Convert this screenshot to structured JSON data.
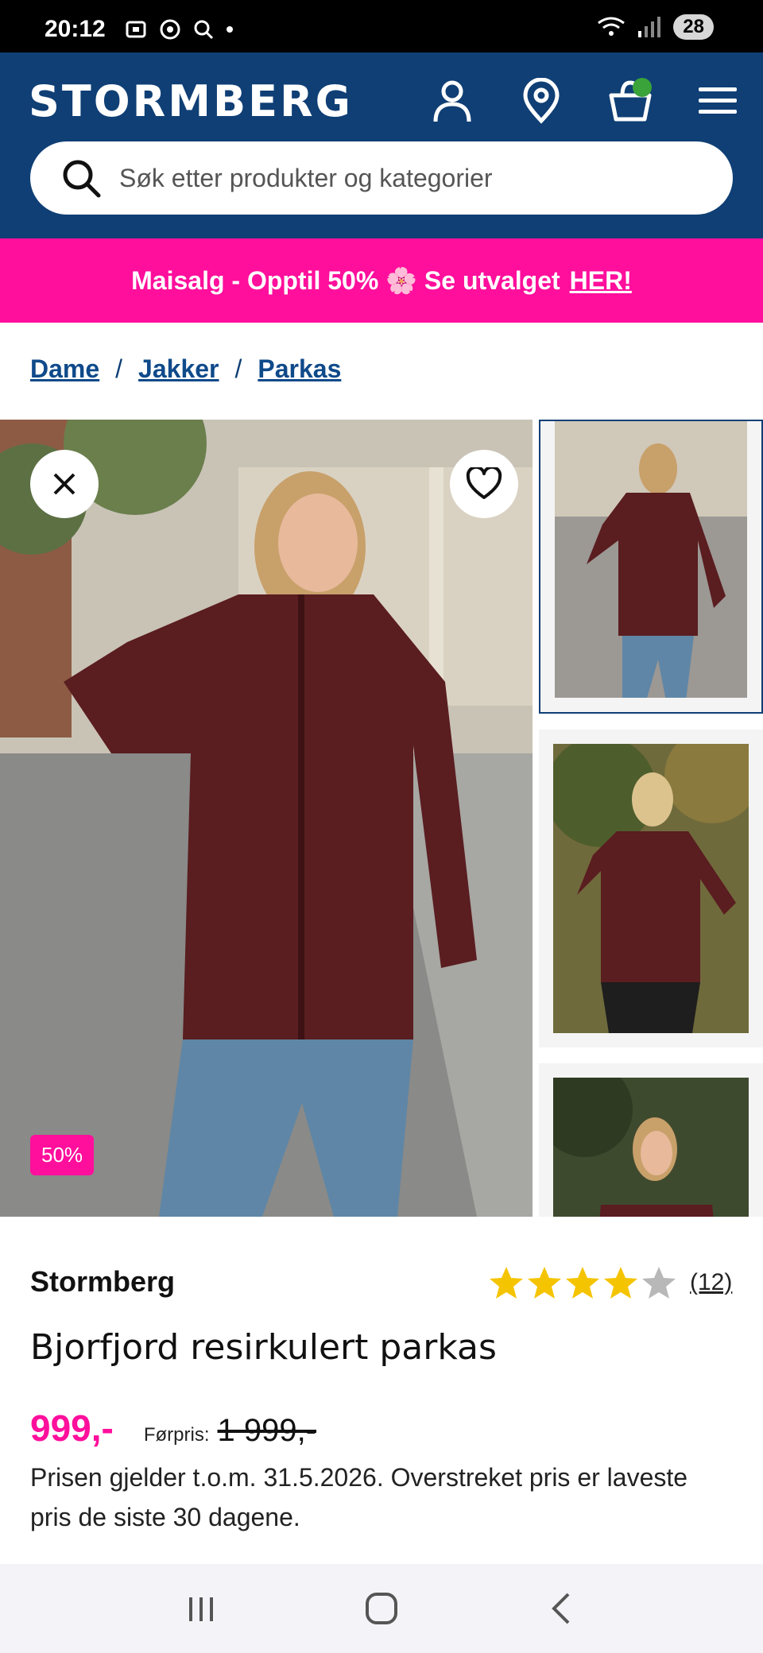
{
  "status_bar": {
    "time": "20:12",
    "battery": "28"
  },
  "header": {
    "logo_text": "STORMBERG",
    "search": {
      "placeholder": "Søk etter produkter og kategorier"
    }
  },
  "promo": {
    "text": "Maisalg - Opptil 50% 🌸 Se utvalget",
    "link": "HER!"
  },
  "breadcrumb": {
    "items": [
      "Dame",
      "Jakker",
      "Parkas"
    ],
    "separator": "/"
  },
  "gallery": {
    "discount_badge": "50%"
  },
  "product": {
    "brand": "Stormberg",
    "rating": {
      "stars": 4,
      "max": 5,
      "count": "(12)"
    },
    "name": "Bjorfjord resirkulert parkas",
    "price": "999,-",
    "previous_price_label": "Førpris:",
    "previous_price": "1 999,-",
    "price_note": "Prisen gjelder t.o.m. 31.5.2026. Overstreket pris er laveste pris de siste 30 dagene."
  },
  "colors": {
    "brand_blue": "#0f3f75",
    "promo_pink": "#ff0f9c",
    "star_yellow": "#f5c400"
  }
}
